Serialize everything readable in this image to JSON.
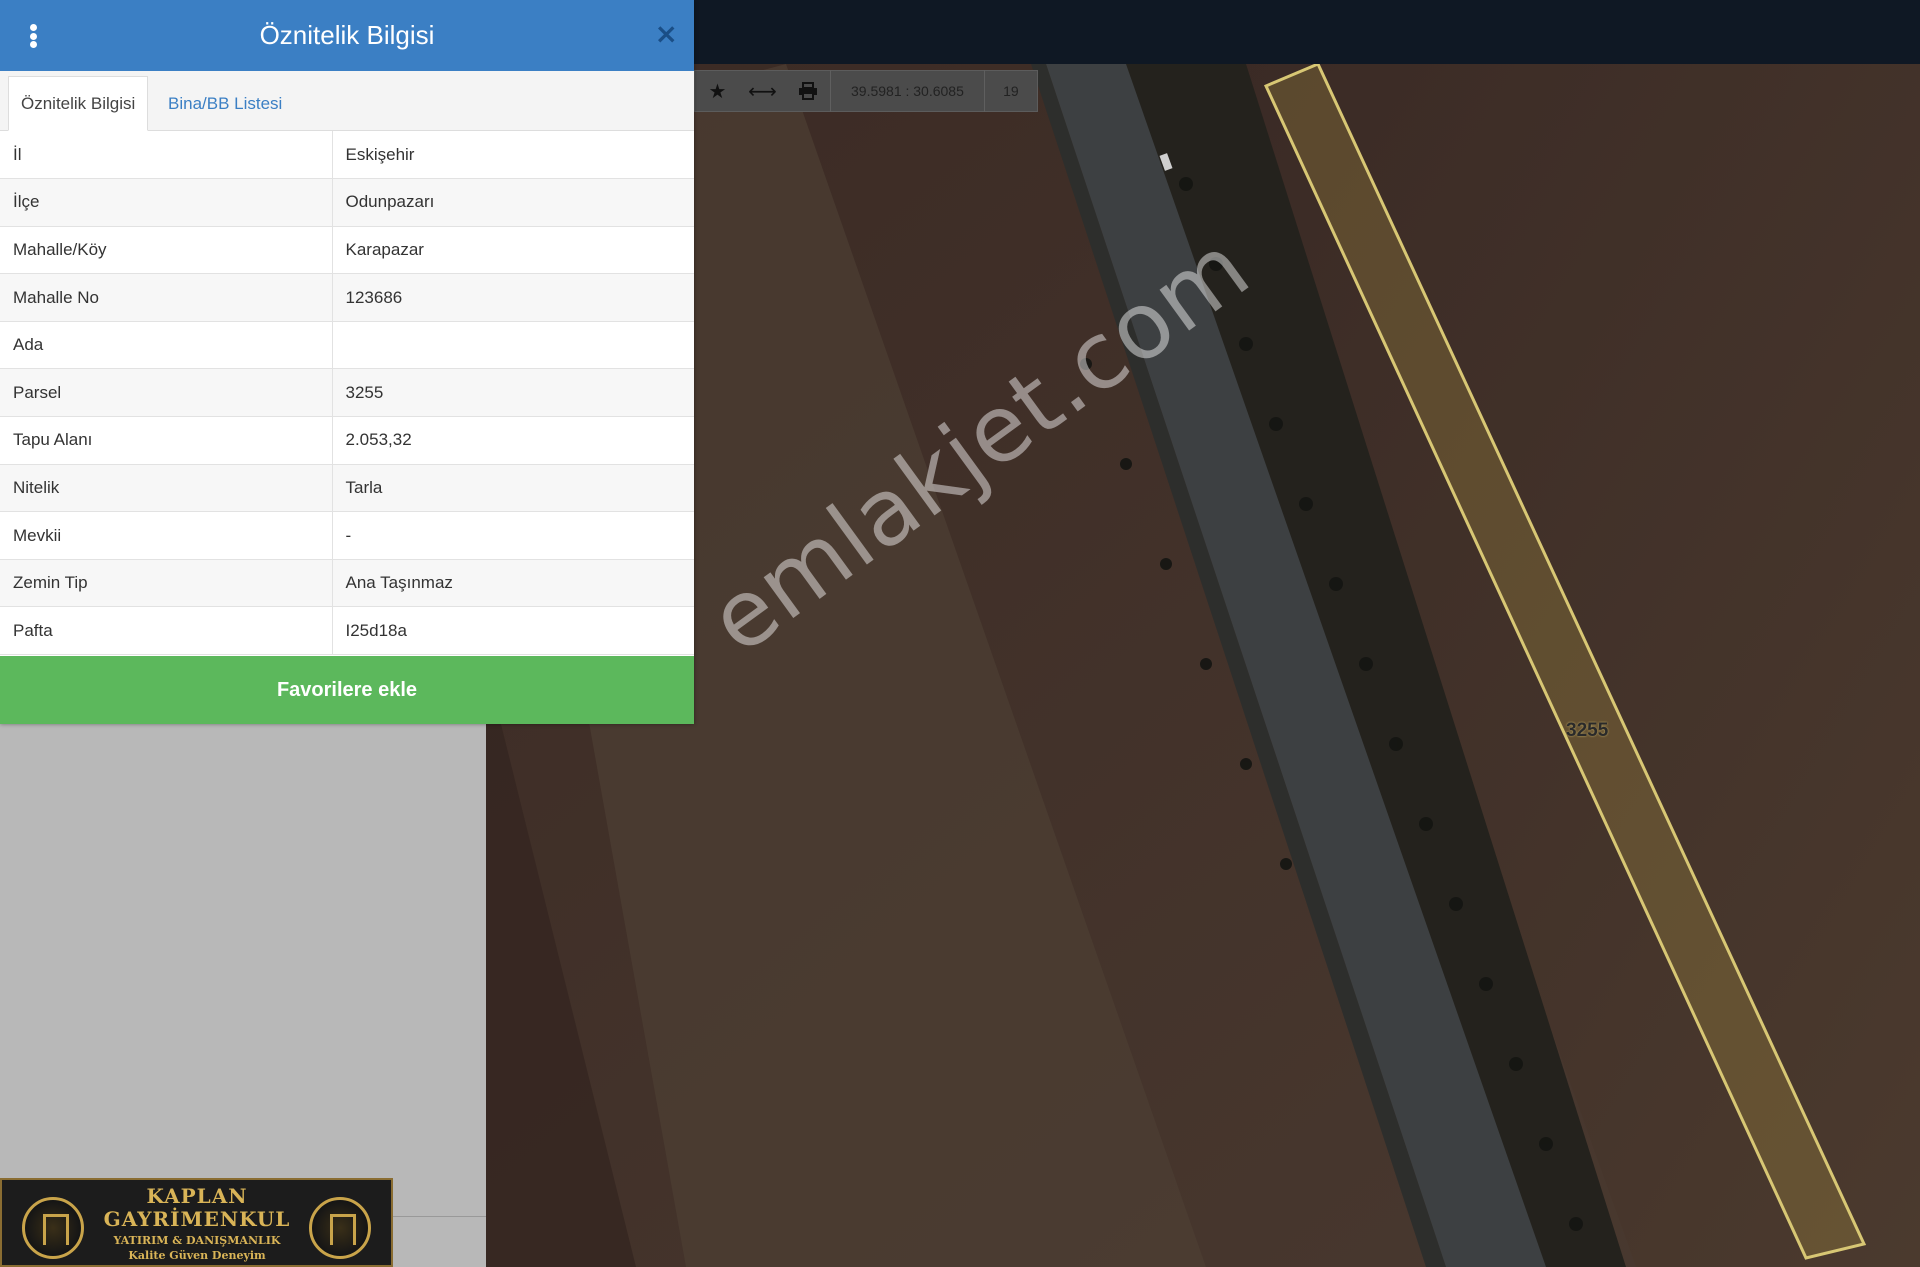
{
  "panel": {
    "title": "Öznitelik Bilgisi",
    "close_label": "×",
    "tabs": [
      {
        "label": "Öznitelik Bilgisi",
        "active": true
      },
      {
        "label": "Bina/BB Listesi",
        "active": false
      }
    ],
    "rows": [
      {
        "key": "İl",
        "value": "Eskişehir"
      },
      {
        "key": "İlçe",
        "value": "Odunpazarı"
      },
      {
        "key": "Mahalle/Köy",
        "value": "Karapazar"
      },
      {
        "key": "Mahalle No",
        "value": "123686"
      },
      {
        "key": "Ada",
        "value": ""
      },
      {
        "key": "Parsel",
        "value": "3255"
      },
      {
        "key": "Tapu Alanı",
        "value": "2.053,32"
      },
      {
        "key": "Nitelik",
        "value": "Tarla"
      },
      {
        "key": "Mevkii",
        "value": "-"
      },
      {
        "key": "Zemin Tip",
        "value": "Ana Taşınmaz"
      },
      {
        "key": "Pafta",
        "value": "I25d18a"
      }
    ],
    "favorite_button": "Favorilere ekle"
  },
  "toolbar": {
    "icons": [
      "star-icon",
      "measure-icon",
      "print-icon"
    ],
    "coordinates": "39.5981 : 30.6085",
    "zoom": "19"
  },
  "map": {
    "parcel_label": "3255",
    "watermark": "emlakjet.com"
  },
  "logo": {
    "line1": "KAPLAN",
    "line2": "GAYRİMENKUL",
    "line3": "YATIRIM & DANIŞMANLIK",
    "line4": "Kalite Güven Deneyim"
  },
  "colors": {
    "header": "#3b7fc4",
    "favorite_button": "#5cb85c",
    "parcel_outline": "#d8c774"
  }
}
